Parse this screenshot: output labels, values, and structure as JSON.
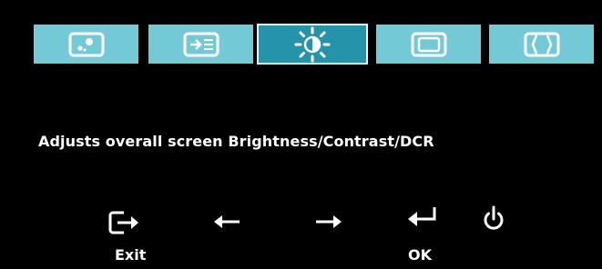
{
  "tabs": [
    {
      "icon": "image-settings-icon",
      "active": false
    },
    {
      "icon": "input-source-icon",
      "active": false
    },
    {
      "icon": "brightness-icon",
      "active": true
    },
    {
      "icon": "image-position-icon",
      "active": false
    },
    {
      "icon": "image-scaling-icon",
      "active": false
    }
  ],
  "description": "Adjusts overall screen Brightness/Contrast/DCR",
  "controls": {
    "exit_label": "Exit",
    "ok_label": "OK"
  },
  "colors": {
    "tab": "#74c9d6",
    "tab_active": "#2593a9",
    "background": "#000000",
    "text": "#ffffff"
  }
}
